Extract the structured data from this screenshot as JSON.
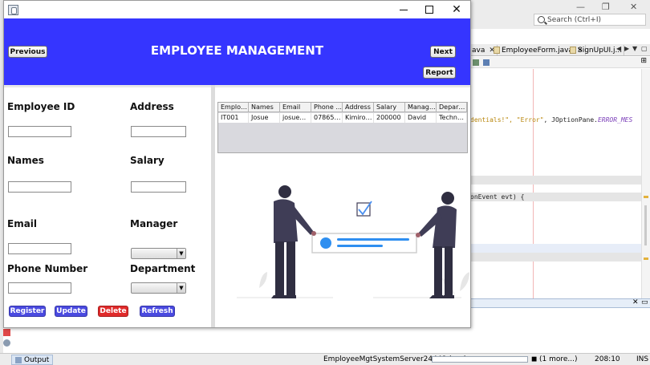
{
  "ide": {
    "search_placeholder": "Search (Ctrl+I)",
    "tabs": [
      {
        "label": "ava"
      },
      {
        "label": "EmployeeForm.java"
      },
      {
        "label": "SignUpUI.j..."
      }
    ],
    "code_lines": [
      {
        "pre": "",
        "str": "dentials!\", \"Error\"",
        "mid": ", JOptionPane.",
        "ital": "ERROR_MES"
      },
      {
        "pre": "onEvent evt) {",
        "str": "",
        "mid": "",
        "ital": ""
      }
    ],
    "output_tab": "Output",
    "run_status": "EmployeeMgtSystemServer24448 (run)",
    "progress_fraction": 0.0,
    "more_label": "(1 more...)",
    "cursor_pos": "208:10",
    "insert_mode": "INS"
  },
  "app": {
    "header": {
      "title": "EMPLOYEE MANAGEMENT",
      "previous_label": "Previous",
      "next_label": "Next",
      "report_label": "Report",
      "color": "#3535ff"
    },
    "form": {
      "employee_id": {
        "label": "Employee ID",
        "value": ""
      },
      "address": {
        "label": "Address",
        "value": ""
      },
      "names": {
        "label": "Names",
        "value": ""
      },
      "salary": {
        "label": "Salary",
        "value": ""
      },
      "email": {
        "label": "Email",
        "value": ""
      },
      "manager": {
        "label": "Manager",
        "selected": ""
      },
      "phone": {
        "label": "Phone Number",
        "value": ""
      },
      "department": {
        "label": "Department",
        "selected": ""
      }
    },
    "actions": {
      "register": {
        "label": "Register",
        "color": "#4a4ae0"
      },
      "update": {
        "label": "Update",
        "color": "#4a4ae0"
      },
      "delete": {
        "label": "Delete",
        "color": "#e02a2a"
      },
      "refresh": {
        "label": "Refresh",
        "color": "#4a4ae0"
      }
    },
    "table": {
      "columns": [
        "Employ...",
        "Names",
        "Email",
        "Phone ...",
        "Address",
        "Salary",
        "Manager",
        "Depart..."
      ],
      "rows": [
        [
          "IT001",
          "Josue",
          "josue@...",
          "078656...",
          "Kimironko",
          "200000",
          "David",
          "Technol..."
        ]
      ]
    }
  }
}
